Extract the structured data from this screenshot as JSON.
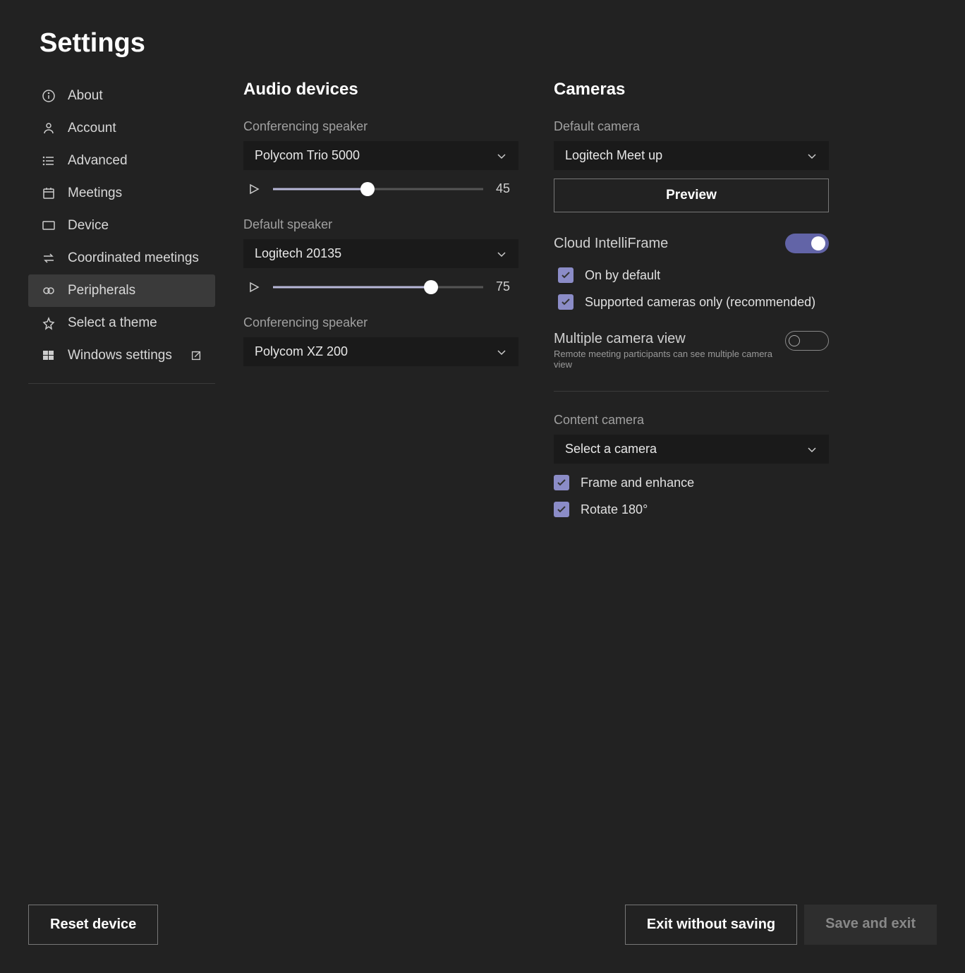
{
  "title": "Settings",
  "sidebar": {
    "items": [
      {
        "label": "About",
        "icon": "info"
      },
      {
        "label": "Account",
        "icon": "account"
      },
      {
        "label": "Advanced",
        "icon": "list"
      },
      {
        "label": "Meetings",
        "icon": "calendar"
      },
      {
        "label": "Device",
        "icon": "monitor"
      },
      {
        "label": "Coordinated meetings",
        "icon": "sync"
      },
      {
        "label": "Peripherals",
        "icon": "peripherals",
        "active": true
      },
      {
        "label": "Select a theme",
        "icon": "theme"
      },
      {
        "label": "Windows settings",
        "icon": "windows",
        "external": true
      }
    ]
  },
  "audio": {
    "title": "Audio devices",
    "conf_speaker_label": "Conferencing speaker",
    "conf_speaker_value": "Polycom Trio 5000",
    "conf_speaker_volume": 45,
    "default_speaker_label": "Default speaker",
    "default_speaker_value": "Logitech 20135",
    "default_speaker_volume": 75,
    "conf_speaker2_label": "Conferencing speaker",
    "conf_speaker2_value": "Polycom XZ 200"
  },
  "cameras": {
    "title": "Cameras",
    "default_camera_label": "Default camera",
    "default_camera_value": "Logitech Meet up",
    "preview_label": "Preview",
    "intelliframe_label": "Cloud IntelliFrame",
    "intelliframe_on": true,
    "on_by_default_label": "On by default",
    "on_by_default_checked": true,
    "supported_only_label": "Supported cameras only (recommended)",
    "supported_only_checked": true,
    "multi_view_label": "Multiple camera view",
    "multi_view_sub": "Remote meeting participants can see multiple camera view",
    "multi_view_on": false,
    "content_camera_label": "Content camera",
    "content_camera_value": "Select a camera",
    "frame_enhance_label": "Frame and enhance",
    "frame_enhance_checked": true,
    "rotate_label": "Rotate 180°",
    "rotate_checked": true
  },
  "footer": {
    "reset_label": "Reset device",
    "exit_label": "Exit without saving",
    "save_label": "Save and exit"
  }
}
